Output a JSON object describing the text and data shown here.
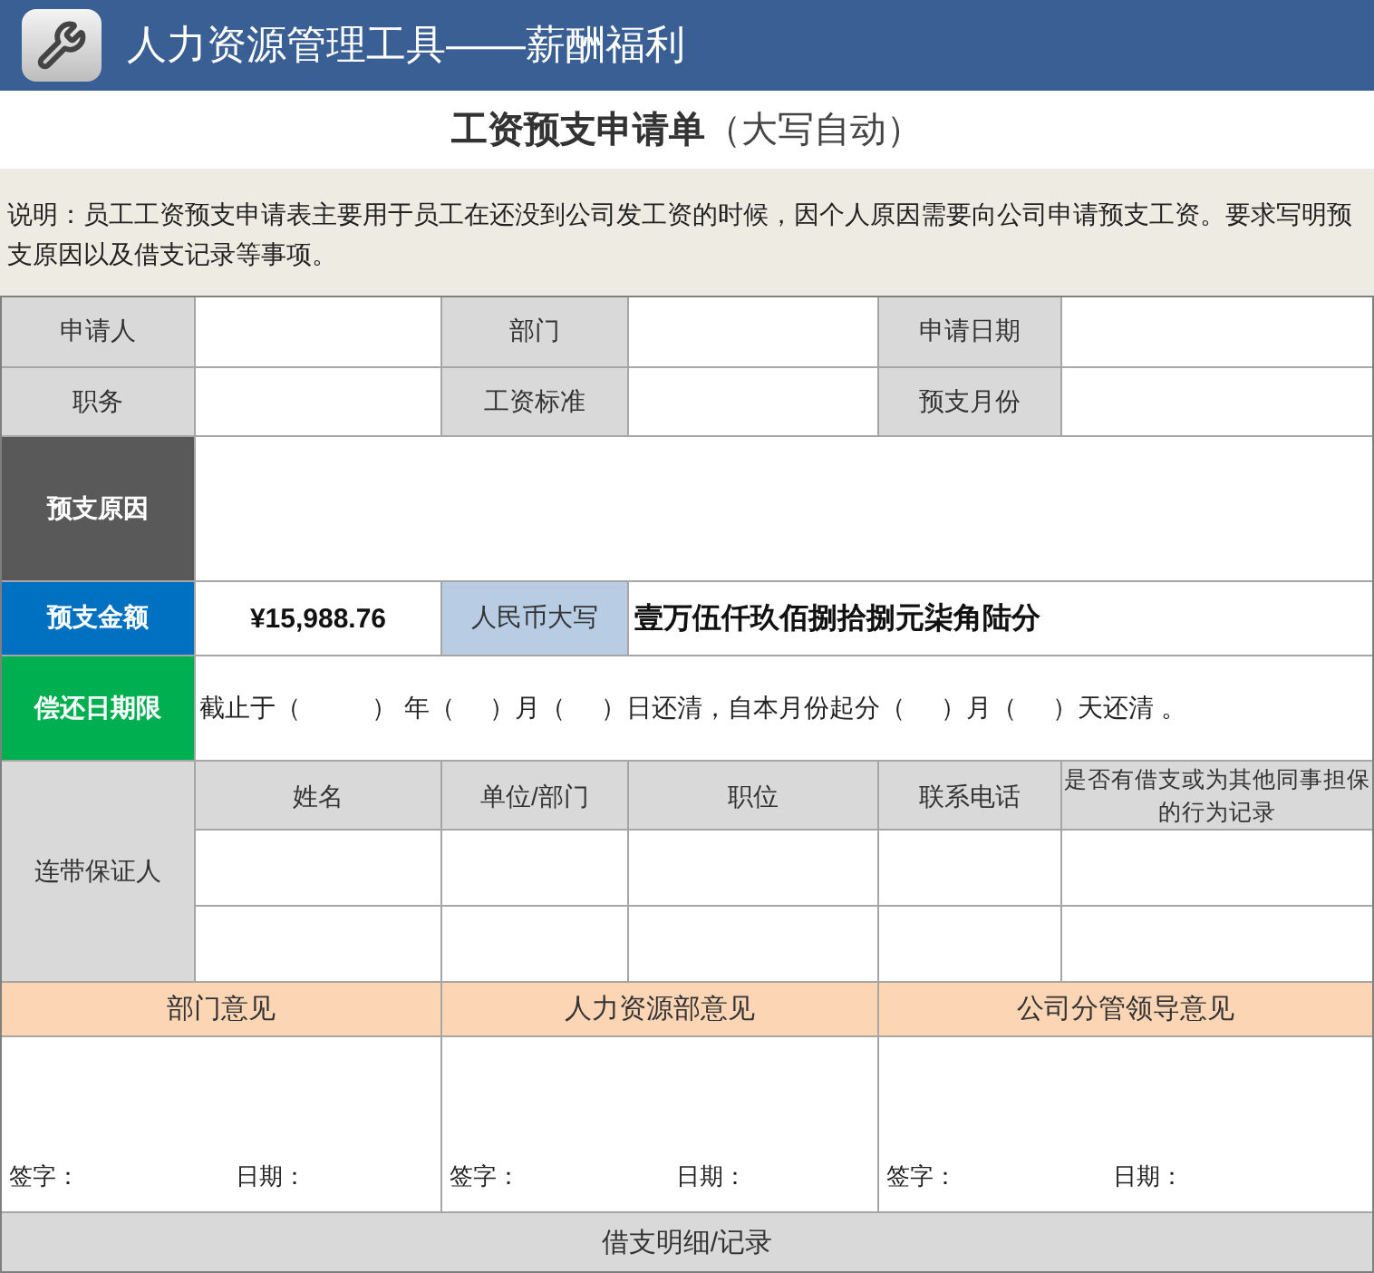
{
  "app_header": {
    "title": "人力资源管理工具——薪酬福利"
  },
  "form_title": {
    "main": "工资预支申请单",
    "note": "（大写自动）"
  },
  "description": "说明：员工工资预支申请表主要用于员工在还没到公司发工资的时候，因个人原因需要向公司申请预支工资。要求写明预支原因以及借支记录等事项。",
  "info_rows": [
    {
      "fields": [
        "申请人",
        "部门",
        "申请日期"
      ]
    },
    {
      "fields": [
        "职务",
        "工资标准",
        "预支月份"
      ]
    }
  ],
  "reason": {
    "label": "预支原因"
  },
  "amount": {
    "label": "预支金额",
    "value": "¥15,988.76",
    "uppercase_label": "人民币大写",
    "uppercase_value": "壹万伍仟玖佰捌拾捌元柒角陆分"
  },
  "repayment": {
    "label": "偿还日期限",
    "text": "截止于（          ） 年（     ）月（     ）日还清，自本月份起分（     ）月（     ）天还清 。"
  },
  "guarantor": {
    "label": "连带保证人",
    "columns": [
      "姓名",
      "单位/部门",
      "职位",
      "联系电话",
      "是否有借支或为其他同事担保的行为记录"
    ]
  },
  "opinions": [
    {
      "title": "部门意见",
      "sign_label": "签字：",
      "date_label": "日期："
    },
    {
      "title": "人力资源部意见",
      "sign_label": "签字：",
      "date_label": "日期："
    },
    {
      "title": "公司分管领导意见",
      "sign_label": "签字：",
      "date_label": "日期："
    }
  ],
  "footer": {
    "title": "借支明细/记录"
  }
}
